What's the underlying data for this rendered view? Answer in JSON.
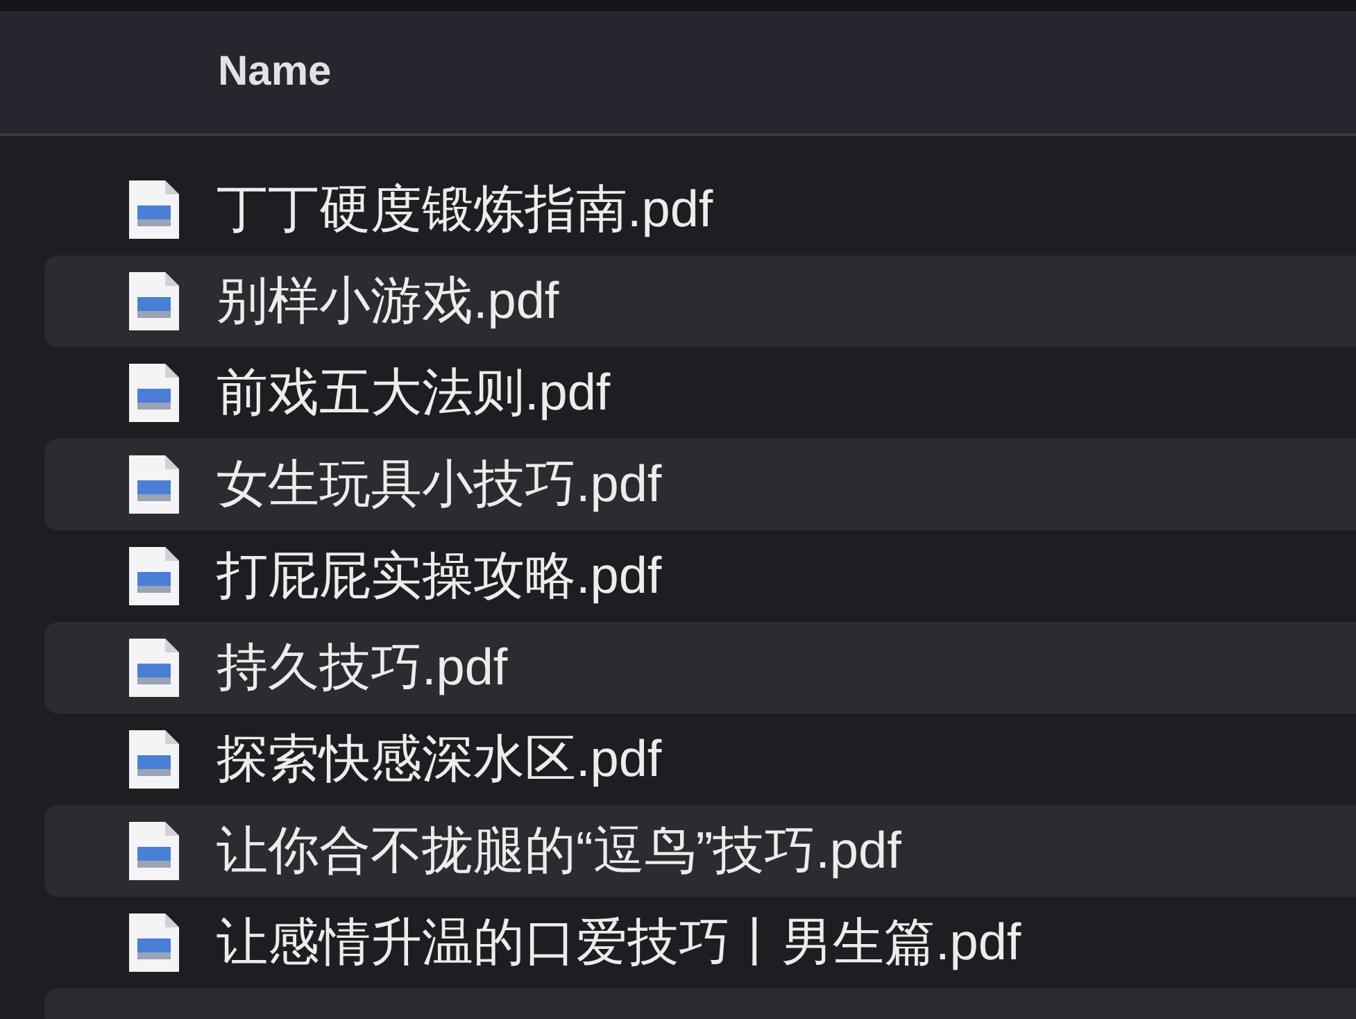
{
  "table": {
    "columns": [
      {
        "label": "Name"
      }
    ],
    "rows": [
      {
        "name": "丁丁硬度锻炼指南.pdf"
      },
      {
        "name": "别样小游戏.pdf"
      },
      {
        "name": "前戏五大法则.pdf"
      },
      {
        "name": "女生玩具小技巧.pdf"
      },
      {
        "name": "打屁屁实操攻略.pdf"
      },
      {
        "name": "持久技巧.pdf"
      },
      {
        "name": "探索快感深水区.pdf"
      },
      {
        "name": "让你合不拢腿的“逗鸟”技巧.pdf"
      },
      {
        "name": "让感情升温的口爱技巧丨男生篇.pdf"
      }
    ]
  }
}
